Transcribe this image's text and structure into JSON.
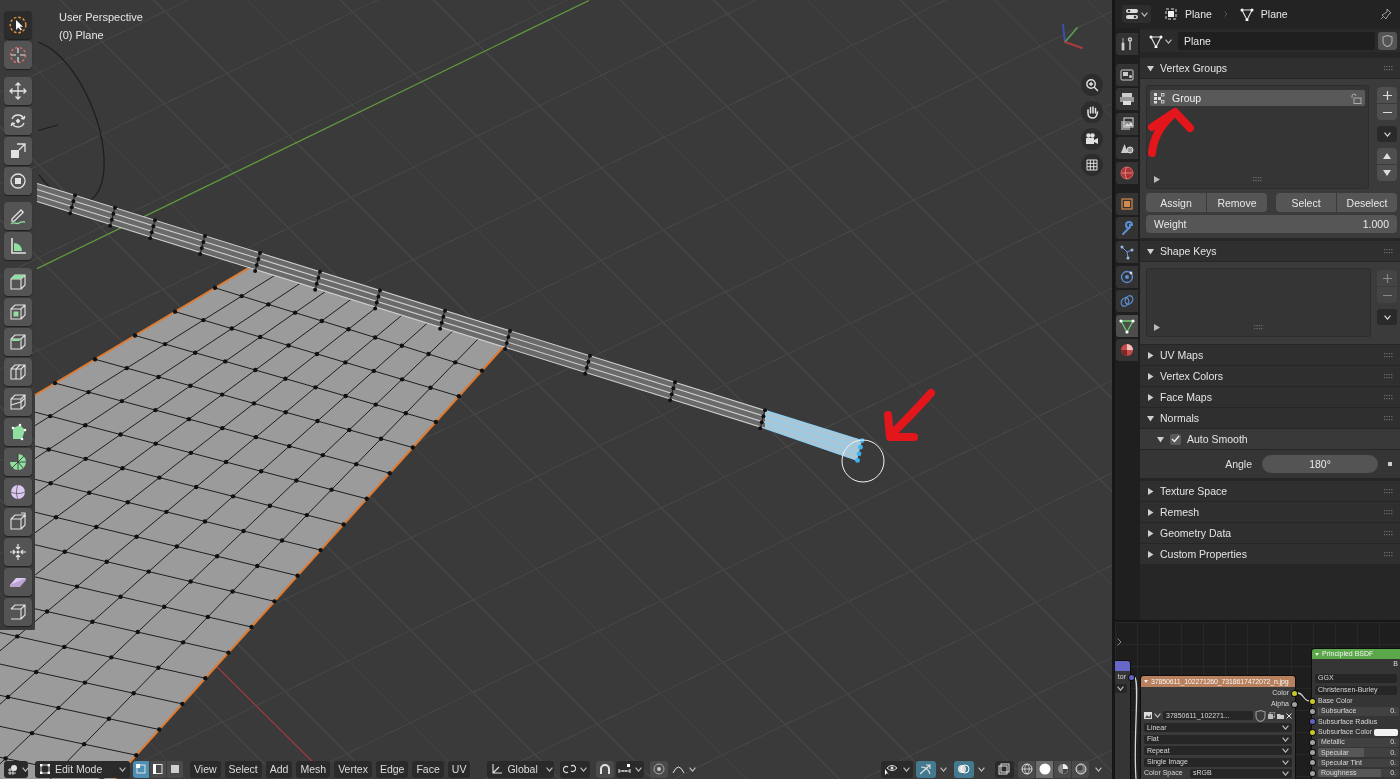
{
  "viewport": {
    "view_name": "User Perspective",
    "object_label": "(0) Plane",
    "tool_groups": [
      {
        "tools": [
          {
            "kind": "select_box",
            "selected": true
          },
          {
            "kind": "cursor",
            "selected": false
          }
        ]
      },
      {
        "tools": [
          {
            "kind": "move",
            "selected": false
          },
          {
            "kind": "rotate",
            "selected": false
          },
          {
            "kind": "scale",
            "selected": false
          },
          {
            "kind": "transform",
            "selected": false
          }
        ]
      },
      {
        "tools": [
          {
            "kind": "annotate",
            "selected": false
          },
          {
            "kind": "measure",
            "selected": false
          }
        ]
      },
      {
        "tools": [
          {
            "kind": "extrude",
            "selected": false
          },
          {
            "kind": "inset",
            "selected": false
          },
          {
            "kind": "bevel",
            "selected": false
          },
          {
            "kind": "loop_cut",
            "selected": false
          },
          {
            "kind": "knife",
            "selected": false
          },
          {
            "kind": "poly_build",
            "selected": false
          },
          {
            "kind": "spin",
            "selected": false
          },
          {
            "kind": "smooth",
            "selected": false
          },
          {
            "kind": "edge_slide",
            "selected": false
          },
          {
            "kind": "shrink",
            "selected": false
          },
          {
            "kind": "shear",
            "selected": false
          },
          {
            "kind": "rip",
            "selected": false
          }
        ]
      }
    ]
  },
  "viewport_header": {
    "mode": "Edit Mode",
    "select_modes": [
      {
        "kind": "vertex",
        "selected": true
      },
      {
        "kind": "edge",
        "selected": false
      },
      {
        "kind": "face",
        "selected": false
      }
    ],
    "menus": [
      "View",
      "Select",
      "Add",
      "Mesh",
      "Vertex",
      "Edge",
      "Face",
      "UV"
    ],
    "orientation": "Global",
    "snap": {
      "on": false
    },
    "proportional": {
      "on": false
    },
    "gizmos": {
      "on": true
    },
    "overlays": {
      "on": true
    },
    "xray": {
      "on": false
    },
    "shading": [
      {
        "kind": "wireframe",
        "selected": false
      },
      {
        "kind": "solid",
        "selected": true
      },
      {
        "kind": "material",
        "selected": false
      },
      {
        "kind": "rendered",
        "selected": false
      }
    ]
  },
  "properties": {
    "object": "Plane",
    "mesh": "Plane",
    "tab_groups": [
      {
        "tabs": [
          {
            "kind": "tool",
            "selected": false
          }
        ]
      },
      {
        "tabs": [
          {
            "kind": "render",
            "selected": false
          },
          {
            "kind": "output",
            "selected": false
          },
          {
            "kind": "view_layer",
            "selected": false
          },
          {
            "kind": "scene",
            "selected": false
          },
          {
            "kind": "world",
            "selected": false
          }
        ]
      },
      {
        "tabs": [
          {
            "kind": "object",
            "selected": false
          },
          {
            "kind": "modifiers",
            "selected": false
          },
          {
            "kind": "particles",
            "selected": false
          },
          {
            "kind": "physics",
            "selected": false
          },
          {
            "kind": "constraints",
            "selected": false
          },
          {
            "kind": "data",
            "selected": true
          },
          {
            "kind": "material",
            "selected": false
          }
        ]
      }
    ],
    "datablock": "Plane",
    "panels": [
      {
        "kind": "vertex_groups",
        "title": "Vertex Groups",
        "expanded": true,
        "groups": [
          {
            "name": "Group",
            "selected": true,
            "locked": false
          }
        ],
        "buttons": [
          "Assign",
          "Remove",
          "Select",
          "Deselect"
        ],
        "weight": {
          "label": "Weight",
          "value": "1.000",
          "level": 1
        }
      },
      {
        "kind": "shape_keys",
        "title": "Shape Keys",
        "expanded": true
      },
      {
        "title": "UV Maps",
        "expanded": false
      },
      {
        "title": "Vertex Colors",
        "expanded": false
      },
      {
        "title": "Face Maps",
        "expanded": false
      },
      {
        "kind": "normals",
        "title": "Normals",
        "expanded": true,
        "auto_smooth": {
          "label": "Auto Smooth",
          "checked": true,
          "expanded": true,
          "angle_label": "Angle",
          "angle": "180°"
        }
      },
      {
        "title": "Texture Space",
        "expanded": false
      },
      {
        "title": "Remesh",
        "expanded": false
      },
      {
        "title": "Geometry Data",
        "expanded": false
      },
      {
        "title": "Custom Properties",
        "expanded": false
      }
    ]
  },
  "node_editor": {
    "nodes": [
      {
        "kind": "partial",
        "rows": [
          "tor"
        ]
      },
      {
        "kind": "image_texture",
        "title": "37850611_102271260_7318617472072_n.jpg",
        "outputs": [
          "Color",
          "Alpha"
        ],
        "image": "37850611_102271...",
        "options": [
          "Linear",
          "Flat",
          "Repeat",
          "Single Image"
        ],
        "color_space_label": "Color Space",
        "color_space": "sRGB"
      },
      {
        "kind": "principled",
        "title": "Principled BSDF",
        "output": "B",
        "options": [
          "GGX",
          "Christensen-Burley"
        ],
        "inputs": [
          {
            "name": "Base Color",
            "kind": "linked"
          },
          {
            "name": "Subsurface",
            "kind": "slider",
            "value": "0.",
            "level": 0
          },
          {
            "name": "Subsurface Radius",
            "kind": "vector"
          },
          {
            "name": "Subsurface Color",
            "kind": "color"
          },
          {
            "name": "Metallic",
            "kind": "slider",
            "value": "0.",
            "level": 0
          },
          {
            "name": "Specular",
            "kind": "slider",
            "value": "0.",
            "level": 0.57
          },
          {
            "name": "Specular Tint",
            "kind": "slider",
            "value": "0.",
            "level": 0
          },
          {
            "name": "Roughness",
            "kind": "slider",
            "value": "0.",
            "level": 0.78
          }
        ]
      }
    ]
  }
}
